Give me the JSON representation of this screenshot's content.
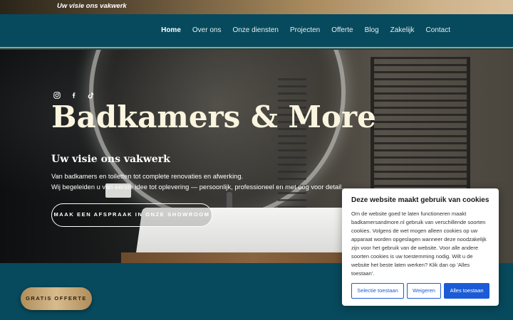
{
  "topbar": {
    "tagline": "Uw visie ons vakwerk"
  },
  "nav": {
    "items": [
      {
        "label": "Home",
        "active": true
      },
      {
        "label": "Over ons"
      },
      {
        "label": "Onze diensten"
      },
      {
        "label": "Projecten"
      },
      {
        "label": "Offerte"
      },
      {
        "label": "Blog"
      },
      {
        "label": "Zakelijk"
      },
      {
        "label": "Contact"
      }
    ]
  },
  "hero": {
    "social_icons": [
      "instagram-icon",
      "facebook-icon",
      "tiktok-icon"
    ],
    "title": "Badkamers & More",
    "subtitle": "Uw visie ons vakwerk",
    "line1": "Van badkamers en toiletten tot complete renovaties en afwerking.",
    "line2": "Wij begeleiden u van eerste idee tot oplevering — persoonlijk, professioneel en met oog voor detail.",
    "cta": "Maak een afspraak in onze showroom"
  },
  "floating_button": {
    "label": "GRATIS OFFERTE"
  },
  "cookie": {
    "title": "Deze website maakt gebruik van cookies",
    "text": "Om de website goed te laten functioneren maakt badkamersandmore.nl gebruik van verschillende soorten cookies. Volgens de wet mogen alleen cookies op uw apparaat worden opgeslagen wanneer deze noodzakelijk zijn voor het gebruik van de website. Voor alle andere soorten cookies is uw toestemming nodig. Wilt u de website het beste laten werken? Klik dan op 'Alles toestaan'.",
    "btn_select": "Selectie toestaan",
    "btn_deny": "Weigeren",
    "btn_all": "Alles toestaan"
  },
  "colors": {
    "nav_bg": "#074a5d",
    "gold": "#b89a6b",
    "cookie_blue": "#1c5bd6"
  }
}
